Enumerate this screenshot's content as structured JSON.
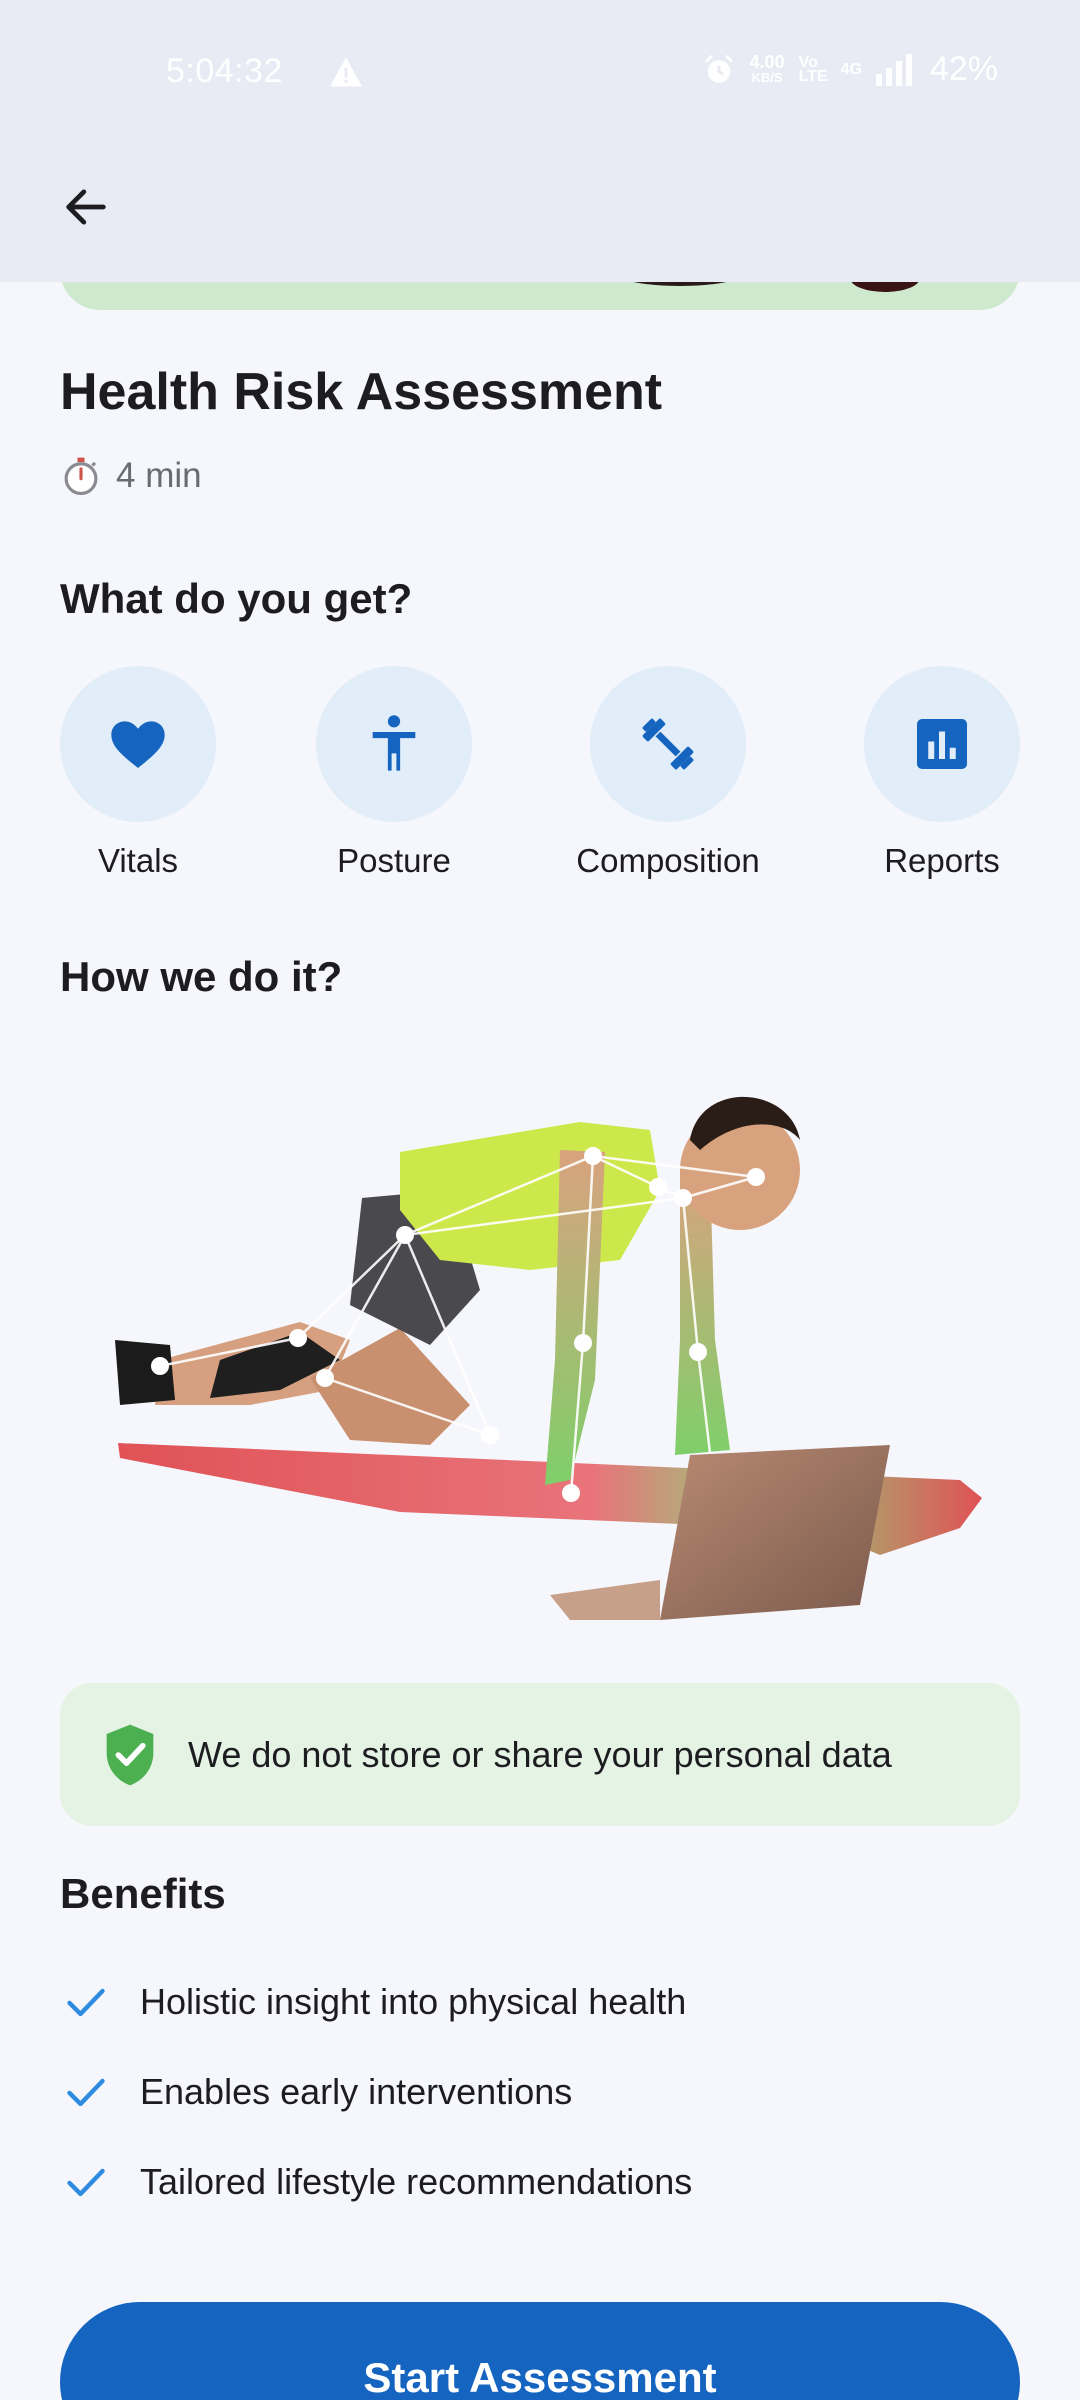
{
  "status_bar": {
    "time": "5:04:32",
    "net_speed_value": "4.00",
    "net_speed_unit": "KB/S",
    "volte": "Vo LTE",
    "network": "4G",
    "battery": "42%"
  },
  "app_bar": {
    "back_icon": "arrow-left-icon"
  },
  "assessment": {
    "title": "Health Risk Assessment",
    "duration": "4 min",
    "duration_icon": "stopwatch-icon"
  },
  "features": {
    "heading": "What do you get?",
    "items": [
      {
        "label": "Vitals",
        "icon": "heart-icon"
      },
      {
        "label": "Posture",
        "icon": "accessibility-icon"
      },
      {
        "label": "Composition",
        "icon": "dumbbell-icon"
      },
      {
        "label": "Reports",
        "icon": "bar-chart-icon"
      }
    ]
  },
  "method": {
    "heading": "How we do it?"
  },
  "privacy": {
    "text": "We do not store or share your personal data",
    "icon": "shield-check-icon"
  },
  "benefits": {
    "heading": "Benefits",
    "items": [
      "Holistic insight into physical health",
      "Enables early interventions",
      "Tailored lifestyle recommendations"
    ]
  },
  "cta": {
    "label": "Start Assessment"
  },
  "colors": {
    "primary": "#1565c0",
    "icon_bg": "#e2edfa",
    "privacy_bg": "#e5f3e5",
    "check": "#2e8be0",
    "shield": "#4caf50"
  }
}
